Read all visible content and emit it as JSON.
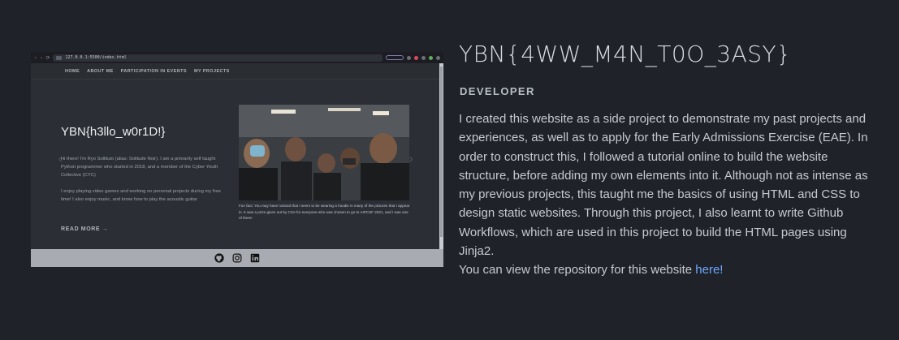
{
  "screenshot": {
    "browser": {
      "url": "127.0.0.1:5500/index.html",
      "nav_glyphs": "‹  ›  ⟳"
    },
    "nav": {
      "items": [
        "HOME",
        "ABOUT ME",
        "PARTICIPATION IN EVENTS",
        "MY PROJECTS"
      ]
    },
    "hero": {
      "title": "YBN{h3llo_w0r1D!}",
      "paragraph1": "Hi there! I'm Ryo Sollituto (alias: Solitude Noir). I am a primarily self taught Python programmer who started in 2018, and a member of the Cyber Youth Collective (CYC)",
      "paragraph2": "I enjoy playing video games and working on personal projects during my free time! I also enjoy music, and know how to play the acoustic guitar",
      "read_more": "READ MORE →",
      "arrow_left": "‹",
      "arrow_right": "›"
    },
    "photo_caption": "Fun fact: You may have noticed that I seem to be wearing a hoodie in many of the pictures that I appear in. It was a prize given out by CSA for everyone who was chosen to go to AIPCSF 2021, and I was one of them!",
    "footer_icons": [
      "github-icon",
      "instagram-icon",
      "linkedin-icon"
    ]
  },
  "project": {
    "title": "YBN{4WW_M4N_T0O_3ASY}",
    "role": "DEVELOPER",
    "description": "I created this website as a side project to demonstrate my past projects and experiences, as well as to apply for the Early Admissions Exercise (EAE). In order to construct this, I followed a tutorial online to build the website structure, before adding my own elements into it. Although not as intense as my previous projects, this taught me the basics of using HTML and CSS to design static websites. Through this project, I also learnt to write Github Workflows, which are used in this project to build the HTML pages using Jinja2.",
    "repo_text": "You can view the repository for this website ",
    "repo_link": "here!"
  },
  "colors": {
    "background": "#1f2329",
    "link": "#6ea8ff"
  }
}
